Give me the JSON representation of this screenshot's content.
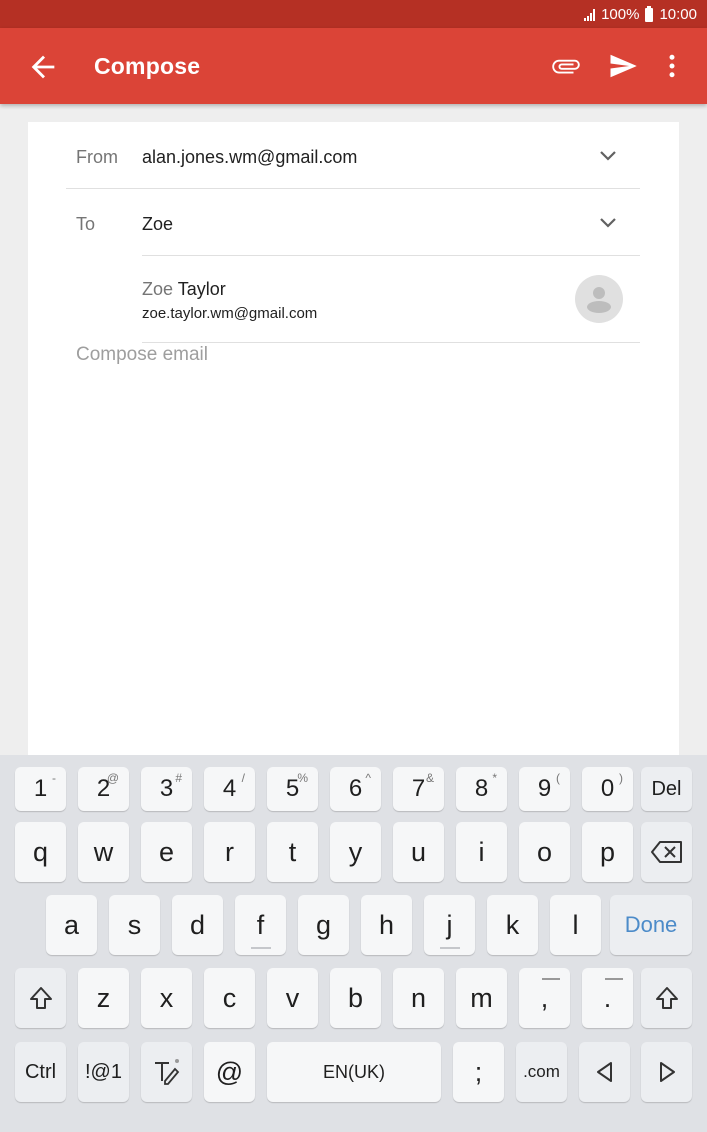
{
  "status": {
    "battery": "100%",
    "time": "10:00"
  },
  "appbar": {
    "title": "Compose"
  },
  "compose": {
    "from_label": "From",
    "from_value": "alan.jones.wm@gmail.com",
    "to_label": "To",
    "to_value": "Zoe",
    "suggestion": {
      "match": "Zoe",
      "rest": " Taylor",
      "email": "zoe.taylor.wm@gmail.com"
    },
    "body_placeholder": "Compose email"
  },
  "keyboard": {
    "numbers": [
      {
        "k": "1",
        "s": "-"
      },
      {
        "k": "2",
        "s": "@"
      },
      {
        "k": "3",
        "s": "#"
      },
      {
        "k": "4",
        "s": "/"
      },
      {
        "k": "5",
        "s": "%"
      },
      {
        "k": "6",
        "s": "^"
      },
      {
        "k": "7",
        "s": "&"
      },
      {
        "k": "8",
        "s": "*"
      },
      {
        "k": "9",
        "s": "("
      },
      {
        "k": "0",
        "s": ")"
      }
    ],
    "del": "Del",
    "row1": [
      "q",
      "w",
      "e",
      "r",
      "t",
      "y",
      "u",
      "i",
      "o",
      "p"
    ],
    "row2": [
      "a",
      "s",
      "d",
      "f",
      "g",
      "h",
      "j",
      "k",
      "l"
    ],
    "done": "Done",
    "row3": [
      "z",
      "x",
      "c",
      "v",
      "b",
      "n",
      "m",
      ",",
      "."
    ],
    "ctrl": "Ctrl",
    "sym": "!@1",
    "at": "@",
    "space": "EN(UK)",
    "semicolon": ";",
    "dotcom": ".com"
  }
}
